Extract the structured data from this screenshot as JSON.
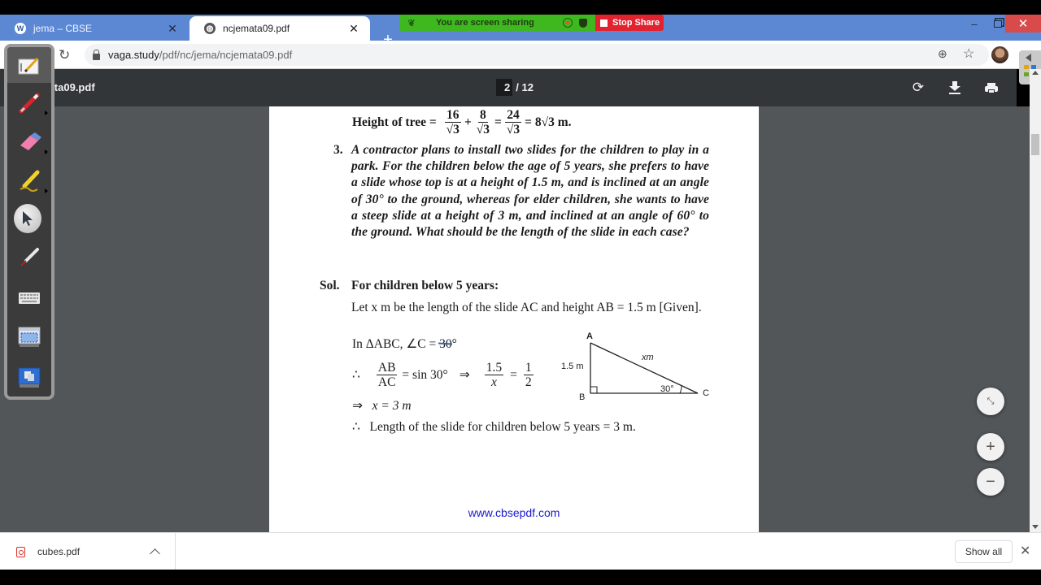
{
  "browser": {
    "tabs": [
      {
        "title": "jema – CBSE",
        "favicon": "wordpress-icon",
        "active": false
      },
      {
        "title": "ncjemata09.pdf",
        "favicon": "globe-icon",
        "active": true
      }
    ],
    "new_tab": "+",
    "url_domain": "vaga.study",
    "url_path": "/pdf/nc/jema/ncjemata09.pdf",
    "window_controls": {
      "minimize": "–",
      "close": "✕"
    }
  },
  "screen_share": {
    "status_text": "You are screen sharing",
    "stop_label": "Stop Share",
    "colors": {
      "active": "#3fb81f",
      "stop": "#e2222e"
    }
  },
  "pdf_viewer": {
    "file_title": "ncjemata09.pdf",
    "current_page": "2",
    "page_separator": "/",
    "total_pages": "12",
    "buttons": {
      "rotate": "rotate-icon",
      "download": "download-icon",
      "print": "print-icon"
    },
    "zoom_buttons": {
      "fit": "fit-to-page-icon",
      "zoom_in": "+",
      "zoom_out": "−"
    }
  },
  "page_content": {
    "height_line": {
      "label": "Height of tree =",
      "frac1_num": "16",
      "frac1_den": "√3",
      "plus": "+",
      "frac2_num": "8",
      "frac2_den": "√3",
      "eq": "=",
      "frac3_num": "24",
      "frac3_den": "√3",
      "result": "= 8√3  m."
    },
    "question_number": "3.",
    "question_text": "A contractor plans to install two slides for the children to play in a park. For the children below the age of 5 years, she prefers to have a slide whose top is at a height of 1.5 m, and is inclined at an angle of 30° to the ground, whereas for elder children, she wants to have a steep slide at a height of 3 m, and inclined at an angle of 60° to the ground. What should be the length of the slide in each case?",
    "sol_label": "Sol.",
    "sol_heading": "For children below 5 years:",
    "given_text": "Let x m be the length of the slide AC and height AB = 1.5 m [Given].",
    "triangle_line": "In ΔABC, ∠C = 30°",
    "therefore_symbol": "∴",
    "ratio_num": "AB",
    "ratio_den": "AC",
    "sin_text": "= sin 30°",
    "implies": "⇒",
    "frac_15_num": "1.5",
    "frac_15_den": "x",
    "equals": "=",
    "half_num": "1",
    "half_den": "2",
    "x_result": "x = 3 m",
    "conclusion": "Length of the slide for children below 5 years = 3 m.",
    "diagram": {
      "vertex_a": "A",
      "vertex_b": "B",
      "vertex_c": "C",
      "side_ab": "1.5 m",
      "side_ac": "xm",
      "angle_c": "30°"
    },
    "footer_link": "www.cbsepdf.com"
  },
  "annotation_toolbar": {
    "tools": [
      "whiteboard-icon",
      "pen-icon",
      "eraser-icon",
      "highlighter-icon",
      "pointer-icon",
      "laser-pen-icon",
      "keyboard-icon",
      "screen-capture-icon",
      "window-capture-icon"
    ]
  },
  "download_shelf": {
    "file_name": "cubes.pdf",
    "show_all_label": "Show all",
    "close": "✕"
  }
}
